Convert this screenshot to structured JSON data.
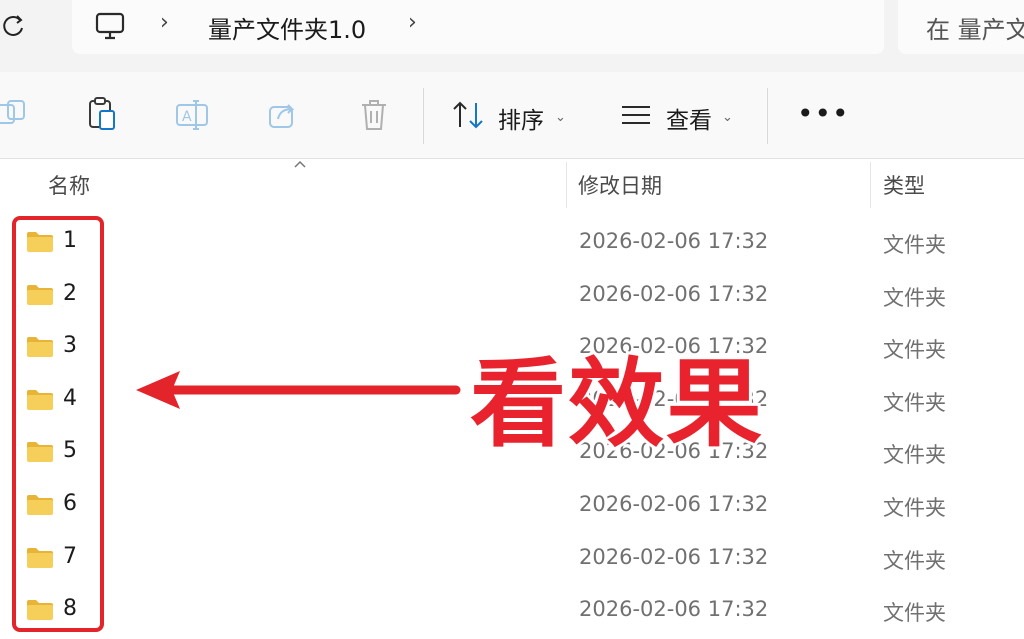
{
  "address_bar": {
    "breadcrumb": "量产文件夹1.0",
    "search_placeholder": "在 量产文"
  },
  "toolbar": {
    "sort_label": "排序",
    "view_label": "查看",
    "more_label": "•••"
  },
  "columns": {
    "name": "名称",
    "date": "修改日期",
    "type": "类型"
  },
  "rows": [
    {
      "name": "1",
      "date": "2026-02-06 17:32",
      "type": "文件夹"
    },
    {
      "name": "2",
      "date": "2026-02-06 17:32",
      "type": "文件夹"
    },
    {
      "name": "3",
      "date": "2026-02-06 17:32",
      "type": "文件夹"
    },
    {
      "name": "4",
      "date": "2026-02-06 17:32",
      "type": "文件夹"
    },
    {
      "name": "5",
      "date": "2026-02-06 17:32",
      "type": "文件夹"
    },
    {
      "name": "6",
      "date": "2026-02-06 17:32",
      "type": "文件夹"
    },
    {
      "name": "7",
      "date": "2026-02-06 17:32",
      "type": "文件夹"
    },
    {
      "name": "8",
      "date": "2026-02-06 17:32",
      "type": "文件夹"
    }
  ],
  "annotation": {
    "caption": "看效果",
    "color": "#e3242b"
  },
  "icons": {
    "refresh": "refresh-icon",
    "computer": "monitor-icon",
    "copy": "copy-icon",
    "paste": "paste-icon",
    "rename": "rename-icon",
    "share": "share-icon",
    "delete": "delete-icon",
    "sort": "sort-icon",
    "view": "view-icon",
    "folder": "folder-icon"
  }
}
